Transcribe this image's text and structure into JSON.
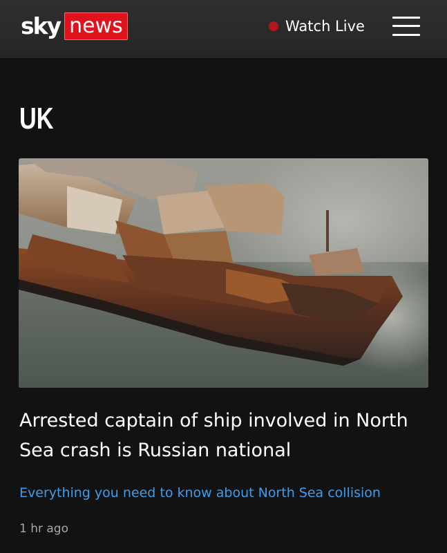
{
  "header": {
    "logo_sky": "sky",
    "logo_news": "news",
    "watch_live": "Watch Live",
    "colors": {
      "background": "#2a2a2a",
      "brand_red": "#e1121c",
      "live_dot": "#b4141c"
    }
  },
  "section": {
    "title": "UK"
  },
  "article": {
    "image_icon": "burnt-cargo-ship-image",
    "headline": "Arrested captain of ship involved in North Sea crash is Russian national",
    "related_link": "Everything you need to know about North Sea collision",
    "timestamp": "1 hr ago",
    "colors": {
      "link": "#3b9ef0",
      "timestamp": "#a8a8a8"
    }
  }
}
